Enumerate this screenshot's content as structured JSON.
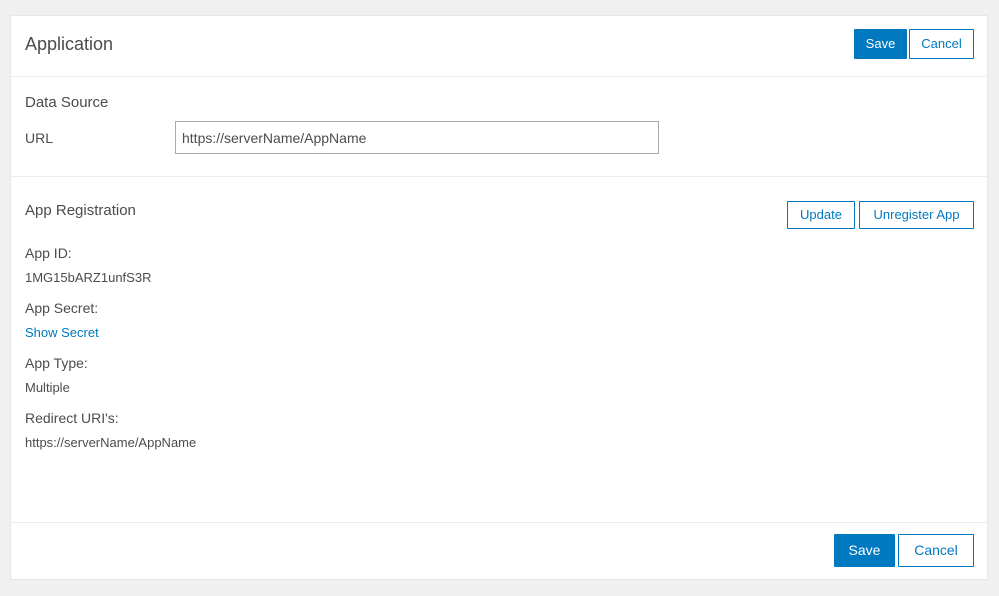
{
  "header": {
    "title": "Application",
    "save_label": "Save",
    "cancel_label": "Cancel"
  },
  "data_source": {
    "title": "Data Source",
    "url_label": "URL",
    "url_value": "https://serverName/AppName"
  },
  "app_registration": {
    "title": "App Registration",
    "update_label": "Update",
    "unregister_label": "Unregister App",
    "app_id_label": "App ID:",
    "app_id_value": "1MG15bARZ1unfS3R",
    "app_secret_label": "App Secret:",
    "show_secret_label": "Show Secret",
    "app_type_label": "App Type:",
    "app_type_value": "Multiple",
    "redirect_label": "Redirect URI's:",
    "redirect_value": "https://serverName/AppName"
  },
  "footer": {
    "save_label": "Save",
    "cancel_label": "Cancel"
  },
  "colors": {
    "accent": "#0079c1",
    "background": "#f0f0f0",
    "panel": "#ffffff",
    "text": "#4c4c4c"
  }
}
